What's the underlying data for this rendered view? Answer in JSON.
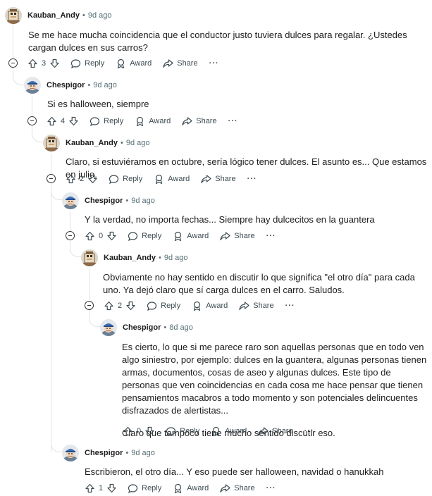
{
  "labels": {
    "reply": "Reply",
    "award": "Award",
    "share": "Share",
    "more": "···",
    "dot": "•"
  },
  "comments": [
    {
      "author": "Kauban_Andy",
      "time": "9d ago",
      "body": [
        "Se me hace mucha coincidencia que el conductor justo tuviera dulces para regalar. ¿Ustedes cargan dulces en sus carros?"
      ],
      "votes": "3"
    },
    {
      "author": "Chespigor",
      "time": "9d ago",
      "body": [
        "Si es halloween, siempre"
      ],
      "votes": "4"
    },
    {
      "author": "Kauban_Andy",
      "time": "9d ago",
      "body": [
        "Claro, si estuviéramos en octubre, sería lógico tener dulces. El asunto es... Que estamos en julio."
      ],
      "votes": "2"
    },
    {
      "author": "Chespigor",
      "time": "9d ago",
      "body": [
        "Y la verdad, no importa fechas... Siempre hay dulcecitos en la guantera"
      ],
      "votes": "0"
    },
    {
      "author": "Kauban_Andy",
      "time": "9d ago",
      "body": [
        "Obviamente no hay sentido en discutir lo que significa \"el otro día\" para cada uno. Ya dejó claro que sí carga dulces en el carro. Saludos."
      ],
      "votes": "2"
    },
    {
      "author": "Chespigor",
      "time": "8d ago",
      "body": [
        "Es cierto, lo que si me parece raro son aquellas personas que en todo ven algo siniestro, por ejemplo: dulces en la guantera, algunas personas tienen armas, documentos, cosas de aseo y algunas dulces. Este tipo de personas que ven coincidencias en cada cosa me hace pensar que tienen pensamientos macabros a todo momento y son potenciales delincuentes disfrazados de alertistas...",
        "Claro que tampoco tiene mucho sentido discutir eso."
      ],
      "votes": "0"
    },
    {
      "author": "Chespigor",
      "time": "9d ago",
      "body": [
        "Escribieron, el otro día... Y eso puede ser halloween, navidad o hanukkah"
      ],
      "votes": "1"
    }
  ],
  "colors": {
    "text": "#1c1c1c",
    "meta": "#576f76",
    "thread_line": "#e0e3e5"
  }
}
